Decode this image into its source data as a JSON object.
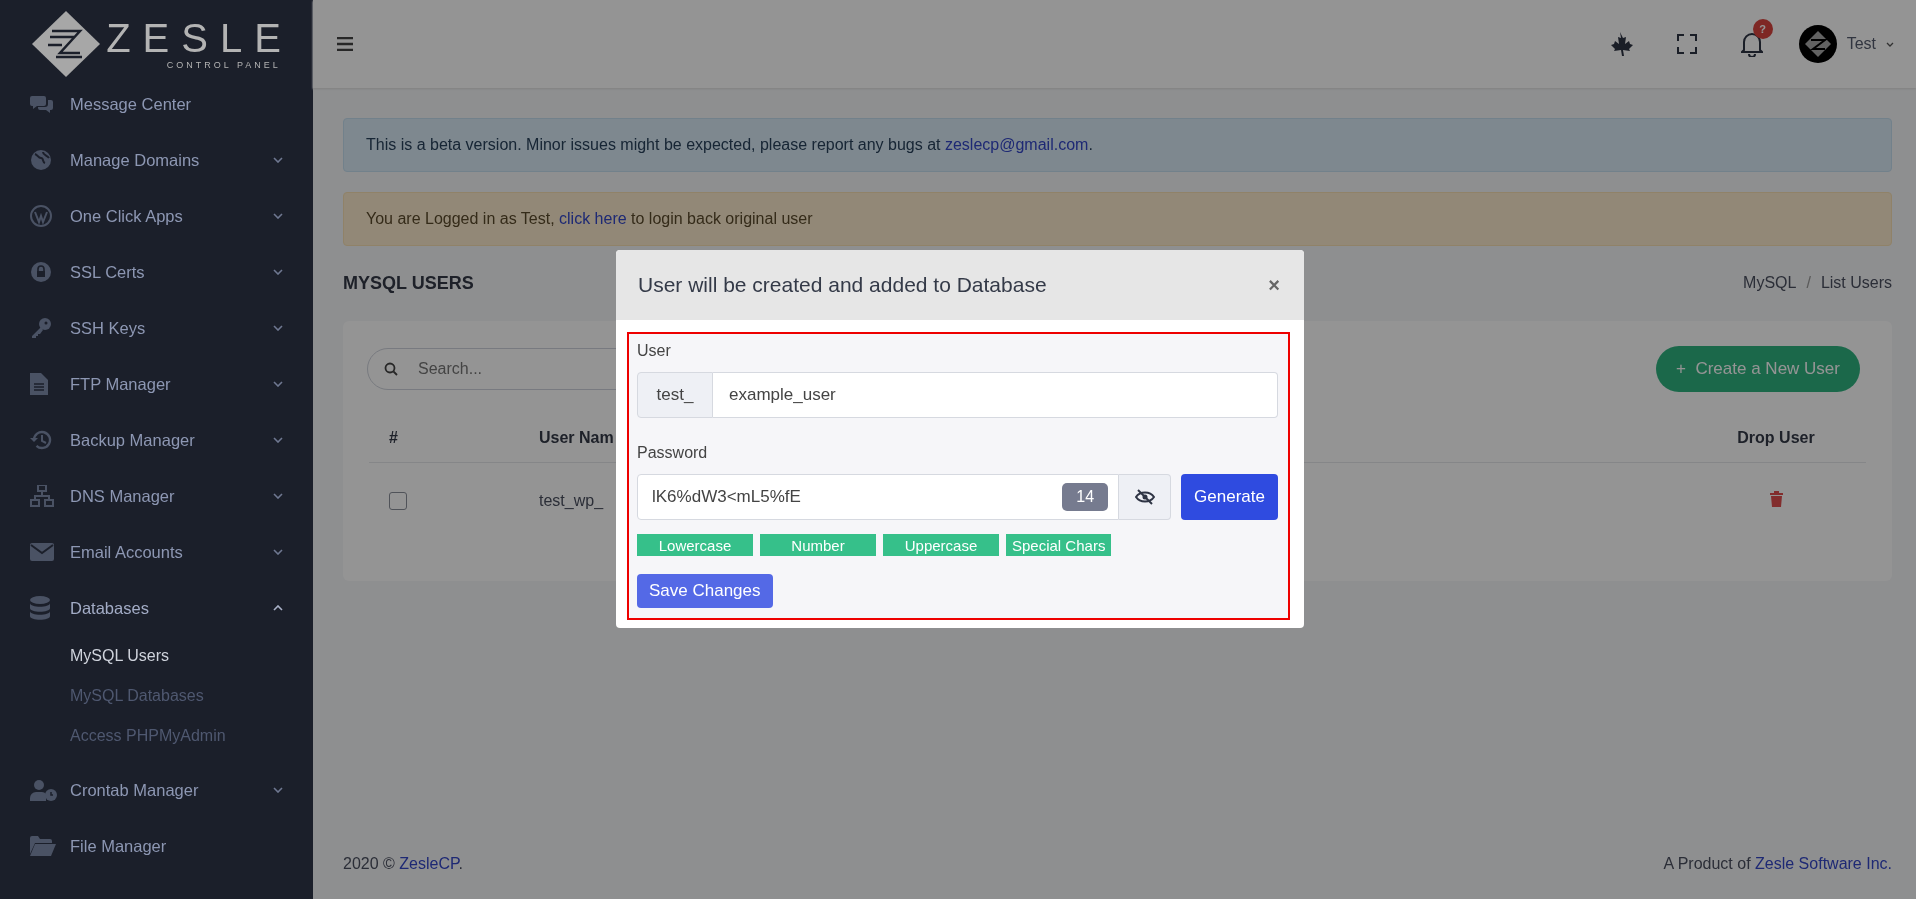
{
  "logo": {
    "name": "ZESLE",
    "tagline": "CONTROL PANEL"
  },
  "sidebar": {
    "items": [
      {
        "label": "Message Center"
      },
      {
        "label": "Manage Domains",
        "expanded": false
      },
      {
        "label": "One Click Apps",
        "expanded": false
      },
      {
        "label": "SSL Certs",
        "expanded": false
      },
      {
        "label": "SSH Keys",
        "expanded": false
      },
      {
        "label": "FTP Manager",
        "expanded": false
      },
      {
        "label": "Backup Manager",
        "expanded": false
      },
      {
        "label": "DNS Manager",
        "expanded": false
      },
      {
        "label": "Email Accounts",
        "expanded": false
      },
      {
        "label": "Databases",
        "expanded": true,
        "children": [
          {
            "label": "MySQL Users",
            "selected": true
          },
          {
            "label": "MySQL Databases",
            "selected": false
          },
          {
            "label": "Access PHPMyAdmin",
            "selected": false
          }
        ]
      },
      {
        "label": "Crontab Manager",
        "expanded": false
      },
      {
        "label": "File Manager"
      }
    ]
  },
  "header": {
    "notification_badge": "?",
    "user": "Test"
  },
  "alerts": [
    {
      "kind": "info",
      "parts": [
        {
          "text": "This is a beta version. Minor issues might be expected, please report any bugs at "
        },
        {
          "text": "zeslecp@gmail.com",
          "link": true
        },
        {
          "text": "."
        }
      ]
    },
    {
      "kind": "warning",
      "parts": [
        {
          "text": "You are Logged in as Test, "
        },
        {
          "text": "click here",
          "link": true
        },
        {
          "text": " to login back original user"
        }
      ]
    }
  ],
  "page": {
    "title": "MYSQL USERS",
    "breadcrumb": [
      "MySQL",
      "List Users"
    ],
    "breadcrumb_separator": "/"
  },
  "card": {
    "search_placeholder": "Search...",
    "create_button": "+  Create a New User",
    "columns": [
      "#",
      "User Nam",
      "Drop User"
    ],
    "rows": [
      {
        "checked": false,
        "user": "test_wp_"
      }
    ]
  },
  "modal": {
    "title": "User will be created and added to Database",
    "close": "×",
    "user_label": "User",
    "user_prefix": "test_",
    "user_value": "example_user",
    "password_label": "Password",
    "password_value": "lK6%dW3<mL5%fE",
    "password_length": "14",
    "generate_button": "Generate",
    "tags": [
      "Lowercase",
      "Number",
      "Uppercase",
      "Special Chars"
    ],
    "save_button": "Save Changes"
  },
  "footer": {
    "year": "2020 © ",
    "brand": "ZesleCP",
    "brand_end": ".",
    "product_prefix": "A Product of ",
    "company": "Zesle Software Inc."
  }
}
